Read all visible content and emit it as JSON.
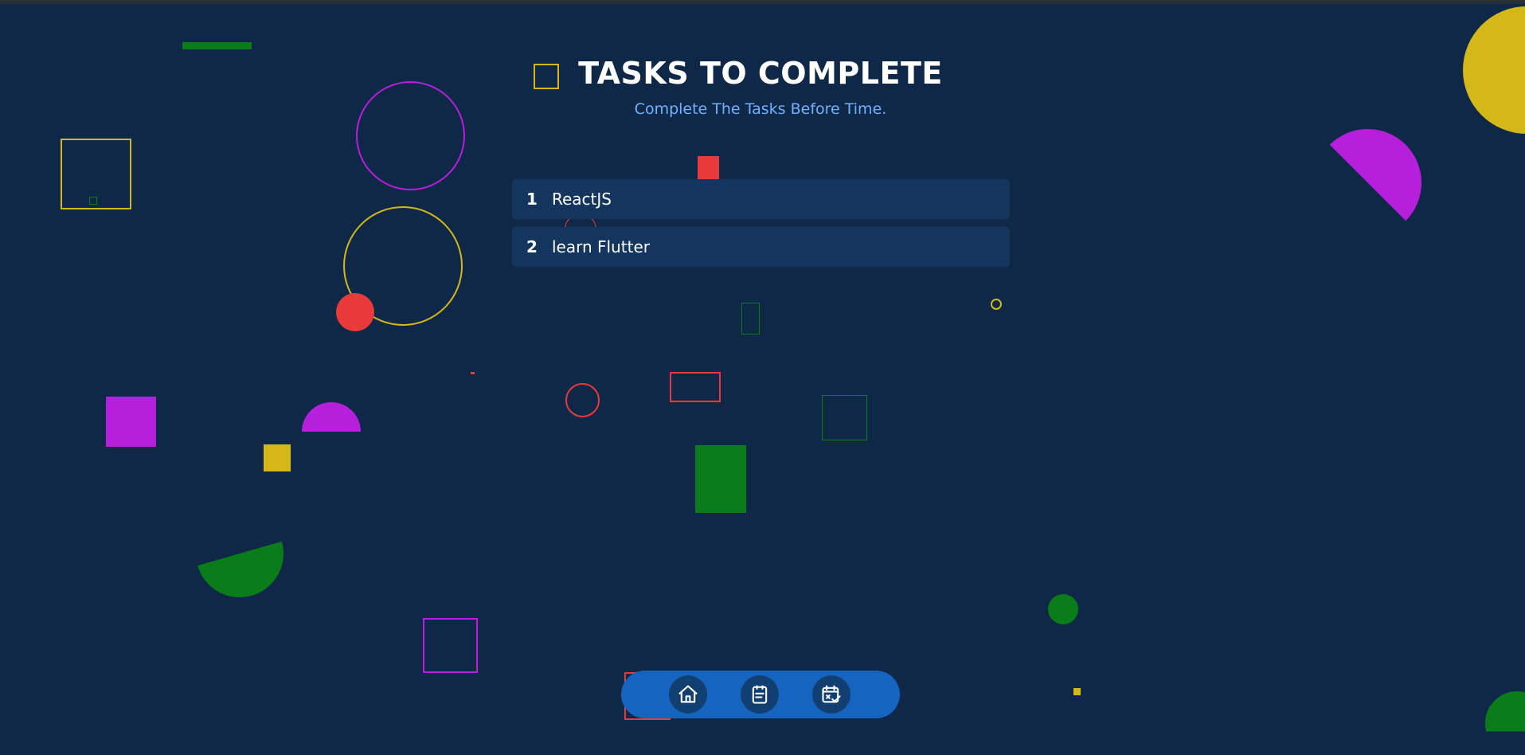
{
  "header": {
    "title": "TASKS TO COMPLETE",
    "subtitle": "Complete The Tasks Before Time."
  },
  "tasks": [
    {
      "number": "1",
      "label": "ReactJS"
    },
    {
      "number": "2",
      "label": "learn Flutter"
    }
  ],
  "nav": {
    "items": [
      {
        "icon": "home-icon"
      },
      {
        "icon": "clipboard-icon"
      },
      {
        "icon": "calendar-check-icon"
      }
    ]
  },
  "colors": {
    "background": "#0f2847",
    "task_row": "#14365e",
    "subtitle": "#6fb2ff",
    "nav_bar": "#1565c0",
    "shape_yellow": "#d4b81a",
    "shape_purple": "#b61fdc",
    "shape_green": "#0a7c1a",
    "shape_red": "#e83a3a"
  }
}
